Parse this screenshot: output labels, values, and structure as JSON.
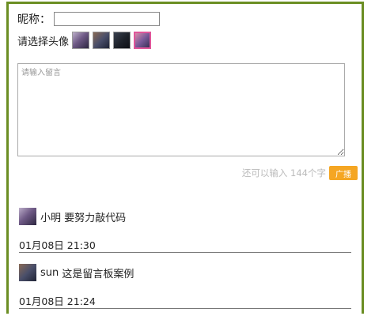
{
  "form": {
    "nickname_label": "昵称：",
    "nickname_value": "",
    "avatar_label": "请选择头像",
    "avatar_options": [
      "avatar-1",
      "avatar-2",
      "avatar-3",
      "avatar-4"
    ],
    "selected_avatar_index": 3,
    "message_placeholder": "请输入留言",
    "remaining_text": "还可以输入 144个字",
    "broadcast_button": "广播"
  },
  "posts": [
    {
      "name": "小明",
      "message": "要努力敲代码",
      "time": "01月08日 21:30"
    },
    {
      "name": "sun",
      "message": "这是留言板案例",
      "time": "01月08日 21:24"
    }
  ],
  "colors": {
    "frame_border": "#6b8e23",
    "button_bg": "#f5a623",
    "selected_avatar_border": "#e0559a"
  }
}
